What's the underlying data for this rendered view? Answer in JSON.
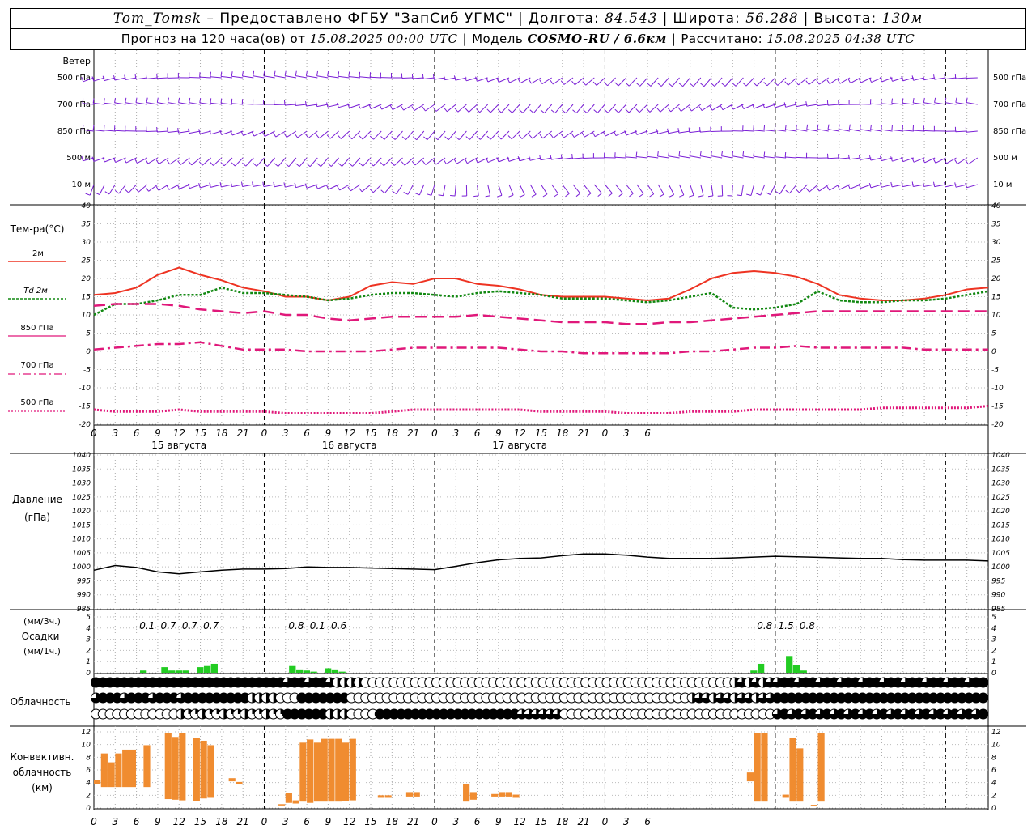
{
  "header": {
    "station": "Tom_Tomsk",
    "provider": "– Предоставлено ФГБУ \"ЗапСиб УГМС\"",
    "lon_label": "Долгота:",
    "lon": "84.543",
    "lat_label": "Широта:",
    "lat": "56.288",
    "alt_label": "Высота:",
    "alt": "130м",
    "forecast_label": "Прогноз на 120 часа(ов) от",
    "forecast_time": "15.08.2025 00:00 UTC",
    "model_label": "Модель",
    "model": "COSMO-RU / 6.6км",
    "calc_label": "Рассчитано:",
    "calc_time": "15.08.2025 04:38 UTC"
  },
  "panels": {
    "wind": {
      "title": "Ветер",
      "levels": [
        "500 гПа",
        "700 гПа",
        "850 гПа",
        "500 м",
        "10  м"
      ]
    },
    "temp": {
      "title": "Тем-ра(°C)",
      "legend": [
        "2м",
        "Td  2м",
        "850 гПа",
        "700 гПа",
        "500 гПа"
      ]
    },
    "pressure": {
      "title": "Давление",
      "unit": "(гПа)"
    },
    "precip": {
      "unit_top": "(мм/3ч.)",
      "title": "Осадки",
      "unit_bottom": "(мм/1ч.)",
      "labels": [
        "0.1",
        "0.7",
        "0.7",
        "0.7",
        "0.8",
        "0.1",
        "0.6",
        "0.8",
        "1.5",
        "0.8"
      ]
    },
    "cloud": {
      "title": "Облачность"
    },
    "conv": {
      "title": [
        "Конвективн.",
        "облачность",
        "(км)"
      ]
    }
  },
  "x_tick_labels": [
    "0",
    "3",
    "6",
    "9",
    "12",
    "15",
    "18",
    "21",
    "0",
    "3",
    "6",
    "9",
    "12",
    "15",
    "18",
    "21",
    "0",
    "3",
    "6",
    "9",
    "12",
    "15",
    "18",
    "21",
    "0",
    "3",
    "6"
  ],
  "day_labels": [
    "15 августа",
    "16 августа",
    "17 августа"
  ],
  "colors": {
    "t2m": "#ee3322",
    "td2m": "#118811",
    "t850": "#e0187a",
    "t700": "#e0187a",
    "t500": "#e0187a",
    "wind": "#7a1fd6",
    "precip": "#22cc22",
    "conv": "#f08c30",
    "pressure": "#000000"
  },
  "chart_data": [
    {
      "type": "wind_barbs",
      "title": "Ветер",
      "levels": [
        "500 гПа",
        "700 гПа",
        "850 гПа",
        "500 м",
        "10  м"
      ],
      "x_hours": [
        0,
        126
      ]
    },
    {
      "type": "line",
      "title": "Тем-ра(°C)",
      "ylim": [
        -20,
        40
      ],
      "yticks": [
        -20,
        -15,
        -10,
        -5,
        0,
        5,
        10,
        15,
        20,
        25,
        30,
        35,
        40
      ],
      "x": [
        0,
        3,
        6,
        9,
        12,
        15,
        18,
        21,
        24,
        27,
        30,
        33,
        36,
        39,
        42,
        45,
        48,
        51,
        54,
        57,
        60,
        63,
        66,
        69,
        72,
        75,
        78,
        81,
        84,
        87,
        90,
        93,
        96,
        99,
        102,
        105,
        108,
        111,
        114,
        117,
        120,
        123,
        126
      ],
      "series": [
        {
          "name": "2м",
          "values": [
            15.5,
            16,
            17.5,
            21,
            23,
            21,
            19.5,
            17.5,
            16.5,
            15,
            15,
            14,
            15,
            18,
            19,
            18.5,
            20,
            20,
            18.5,
            18,
            17,
            15.5,
            15,
            15,
            15,
            14.5,
            14,
            14.5,
            17,
            20,
            21.5,
            22,
            21.5,
            20.5,
            18.5,
            15.5,
            14.5,
            14,
            14,
            14.5,
            15.5,
            17,
            17.5
          ]
        },
        {
          "name": "Td  2м",
          "values": [
            10,
            13,
            13,
            14,
            15.5,
            15.5,
            17.5,
            16,
            16,
            15.5,
            15,
            14,
            14.5,
            15.5,
            16,
            16,
            15.5,
            15,
            16,
            16.5,
            16,
            15.5,
            14.5,
            14.5,
            14.5,
            14,
            13.5,
            14,
            15,
            16,
            12,
            11.5,
            12,
            13,
            16.5,
            14,
            13.5,
            13.5,
            14,
            14,
            14.5,
            15.5,
            16.5
          ]
        },
        {
          "name": "850 гПа",
          "values": [
            12.5,
            13,
            13,
            13,
            12.5,
            11.5,
            11,
            10.5,
            11,
            10,
            10,
            9,
            8.5,
            9,
            9.5,
            9.5,
            9.5,
            9.5,
            10,
            9.5,
            9,
            8.5,
            8,
            8,
            8,
            7.5,
            7.5,
            8,
            8,
            8.5,
            9,
            9.5,
            10,
            10.5,
            11,
            11,
            11,
            11,
            11,
            11,
            11,
            11,
            11
          ]
        },
        {
          "name": "700 гПа",
          "values": [
            0.5,
            1,
            1.5,
            2,
            2,
            2.5,
            1.5,
            0.5,
            0.5,
            0.5,
            0,
            0,
            0,
            0,
            0.5,
            1,
            1,
            1,
            1,
            1,
            0.5,
            0,
            0,
            -0.5,
            -0.5,
            -0.5,
            -0.5,
            -0.5,
            0,
            0,
            0.5,
            1,
            1,
            1.5,
            1,
            1,
            1,
            1,
            1,
            0.5,
            0.5,
            0.5,
            0.5
          ]
        },
        {
          "name": "500 гПа",
          "values": [
            -16,
            -16.5,
            -16.5,
            -16.5,
            -16,
            -16.5,
            -16.5,
            -16.5,
            -16.5,
            -17,
            -17,
            -17,
            -17,
            -17,
            -16.5,
            -16,
            -16,
            -16,
            -16,
            -16,
            -16,
            -16.5,
            -16.5,
            -16.5,
            -16.5,
            -17,
            -17,
            -17,
            -16.5,
            -16.5,
            -16.5,
            -16,
            -16,
            -16,
            -16,
            -16,
            -16,
            -15.5,
            -15.5,
            -15.5,
            -15.5,
            -15.5,
            -15
          ]
        }
      ]
    },
    {
      "type": "line",
      "title": "Давление",
      "ylabel": "(гПа)",
      "ylim": [
        985,
        1040
      ],
      "yticks": [
        985,
        990,
        995,
        1000,
        1005,
        1010,
        1015,
        1020,
        1025,
        1030,
        1035,
        1040
      ],
      "x": [
        0,
        3,
        6,
        9,
        12,
        15,
        18,
        21,
        24,
        27,
        30,
        33,
        36,
        39,
        42,
        45,
        48,
        51,
        54,
        57,
        60,
        63,
        66,
        69,
        72,
        75,
        78,
        81,
        84,
        87,
        90,
        93,
        96,
        99,
        102,
        105,
        108,
        111,
        114,
        117,
        120,
        123,
        126
      ],
      "series": [
        {
          "name": "",
          "values": [
            998.8,
            1000.5,
            999.8,
            998.2,
            997.5,
            998.2,
            998.8,
            999.2,
            999.2,
            999.4,
            1000,
            999.8,
            999.8,
            999.6,
            999.4,
            999.2,
            999,
            1000.2,
            1001.5,
            1002.5,
            1003,
            1003.2,
            1004,
            1004.6,
            1004.6,
            1004.2,
            1003.5,
            1003,
            1003,
            1003,
            1003.2,
            1003.5,
            1003.8,
            1003.6,
            1003.4,
            1003.2,
            1003,
            1003,
            1002.6,
            1002.4,
            1002.4,
            1002.4,
            1002.1
          ]
        }
      ]
    },
    {
      "type": "bar",
      "title": "Осадки",
      "ylabel": "(мм/1ч.)",
      "ylim": [
        0,
        5
      ],
      "x": [
        7,
        10,
        11,
        12,
        13,
        15,
        16,
        17,
        28,
        29,
        30,
        31,
        33,
        34,
        35,
        93,
        94,
        98,
        99,
        100
      ],
      "values": [
        0.2,
        0.5,
        0.2,
        0.2,
        0.2,
        0.5,
        0.6,
        0.8,
        0.6,
        0.3,
        0.2,
        0.1,
        0.4,
        0.3,
        0.1,
        0.2,
        0.8,
        1.5,
        0.7,
        0.2
      ],
      "annotations": [
        "0.1",
        "0.7",
        "0.7",
        "0.7",
        "0.8",
        "0.1",
        "0.6",
        "0.8",
        "1.5",
        "0.8"
      ]
    },
    {
      "type": "symbols",
      "title": "Облачность",
      "rows": 3,
      "x_hours": [
        0,
        126
      ]
    },
    {
      "type": "bar",
      "title": "Конвективн. облачность (км)",
      "ylim": [
        0,
        12
      ],
      "yticks": [
        0,
        2,
        4,
        6,
        8,
        10,
        12
      ],
      "bars": [
        {
          "x": 0,
          "base": 3.8,
          "top": 4.4
        },
        {
          "x": 1,
          "base": 3.3,
          "top": 8.6
        },
        {
          "x": 2,
          "base": 3.3,
          "top": 7.2
        },
        {
          "x": 3,
          "base": 3.3,
          "top": 8.6
        },
        {
          "x": 4,
          "base": 3.3,
          "top": 9.2
        },
        {
          "x": 5,
          "base": 3.3,
          "top": 9.2
        },
        {
          "x": 7,
          "base": 3.3,
          "top": 9.9
        },
        {
          "x": 10,
          "base": 1.4,
          "top": 11.8
        },
        {
          "x": 11,
          "base": 1.3,
          "top": 11.2
        },
        {
          "x": 12,
          "base": 1.2,
          "top": 11.8
        },
        {
          "x": 14,
          "base": 1.1,
          "top": 11.1
        },
        {
          "x": 15,
          "base": 1.5,
          "top": 10.6
        },
        {
          "x": 16,
          "base": 1.6,
          "top": 9.9
        },
        {
          "x": 19,
          "base": 4.2,
          "top": 4.7
        },
        {
          "x": 20,
          "base": 3.7,
          "top": 4.1
        },
        {
          "x": 26,
          "base": 0.4,
          "top": 0.6
        },
        {
          "x": 27,
          "base": 0.8,
          "top": 2.4
        },
        {
          "x": 28,
          "base": 0.7,
          "top": 1.2
        },
        {
          "x": 29,
          "base": 1.0,
          "top": 10.3
        },
        {
          "x": 30,
          "base": 0.8,
          "top": 10.8
        },
        {
          "x": 31,
          "base": 1.0,
          "top": 10.3
        },
        {
          "x": 32,
          "base": 1.0,
          "top": 10.9
        },
        {
          "x": 33,
          "base": 1.0,
          "top": 10.9
        },
        {
          "x": 34,
          "base": 1.0,
          "top": 10.9
        },
        {
          "x": 35,
          "base": 1.1,
          "top": 10.3
        },
        {
          "x": 36,
          "base": 1.2,
          "top": 10.9
        },
        {
          "x": 40,
          "base": 1.6,
          "top": 2.0
        },
        {
          "x": 41,
          "base": 1.6,
          "top": 2.0
        },
        {
          "x": 44,
          "base": 1.8,
          "top": 2.5
        },
        {
          "x": 45,
          "base": 1.8,
          "top": 2.5
        },
        {
          "x": 52,
          "base": 1.0,
          "top": 3.8
        },
        {
          "x": 53,
          "base": 1.3,
          "top": 2.5
        },
        {
          "x": 56,
          "base": 1.8,
          "top": 2.2
        },
        {
          "x": 57,
          "base": 1.8,
          "top": 2.5
        },
        {
          "x": 58,
          "base": 1.8,
          "top": 2.5
        },
        {
          "x": 59,
          "base": 1.6,
          "top": 2.1
        },
        {
          "x": 92,
          "base": 4.2,
          "top": 5.6
        },
        {
          "x": 93,
          "base": 1.0,
          "top": 11.8
        },
        {
          "x": 94,
          "base": 1.0,
          "top": 11.8
        },
        {
          "x": 97,
          "base": 1.6,
          "top": 2.1
        },
        {
          "x": 98,
          "base": 1.0,
          "top": 11.0
        },
        {
          "x": 99,
          "base": 1.0,
          "top": 9.4
        },
        {
          "x": 101,
          "base": 0.3,
          "top": 0.5
        },
        {
          "x": 102,
          "base": 1.0,
          "top": 11.8
        }
      ]
    }
  ]
}
